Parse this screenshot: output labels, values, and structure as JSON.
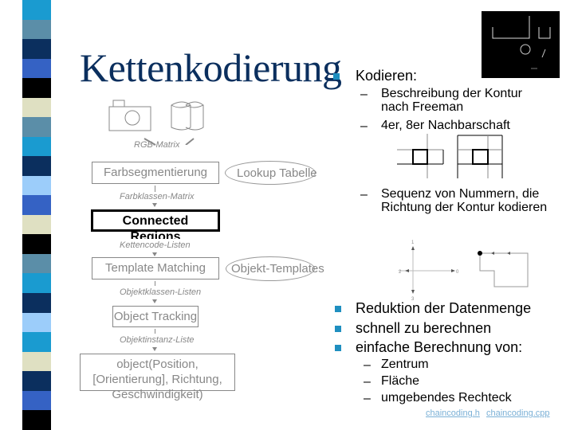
{
  "slide": {
    "title": "Kettenkodierung",
    "stripe_colors": [
      "#1a9bd0",
      "#5b8ea8",
      "#0b2f5e",
      "#3562c4",
      "#000000",
      "#dfe0c2",
      "#5b8ea8",
      "#1a9bd0",
      "#0b2f5e",
      "#9ccdfa",
      "#3562c4",
      "#dfe0c2",
      "#000000",
      "#5b8ea8",
      "#1a9bd0",
      "#0b2f5e",
      "#9ccdfa",
      "#1a9bd0",
      "#dfe0c2",
      "#0b2f5e",
      "#3562c4",
      "#000000"
    ],
    "accent_color": "#1f8fc0",
    "title_color": "#0b2f5e"
  },
  "right": {
    "kodieren": "Kodieren:",
    "sub1": "Beschreibung der Kontur nach Freeman",
    "sub2": "4er, 8er Nachbarschaft",
    "sub3": "Sequenz von Nummern, die Richtung der Kontur kodieren",
    "bullets": [
      "Reduktion der Datenmenge",
      "schnell zu berechnen",
      "einfache Berechnung von:"
    ],
    "subbullets": [
      "Zentrum",
      "Fläche",
      "umgebendes Rechteck"
    ],
    "dash": "–",
    "links": [
      "chaincoding.h",
      "chaincoding.cpp"
    ],
    "direction_labels": {
      "up": "1",
      "left": "2",
      "right": "0",
      "down": "3"
    }
  },
  "diagram": {
    "rgb_matrix": "RGB-Matrix",
    "farbsegmentierung": "Farbsegmentierung",
    "lookup_tabelle": "Lookup Tabelle",
    "farbklassen_matrix": "Farbklassen-Matrix",
    "connected_regions": "Connected Regions",
    "kettencode_listen": "Kettencode-Listen",
    "template_matching": "Template Matching",
    "objekt_templates": "Objekt-Templates",
    "objektklassen_listen": "Objektklassen-Listen",
    "object_tracking": "Object Tracking",
    "objektinstanz_liste": "Objektinstanz-Liste",
    "object_output": "object(Position, [Orientierung], Richtung, Geschwindigkeit)"
  }
}
